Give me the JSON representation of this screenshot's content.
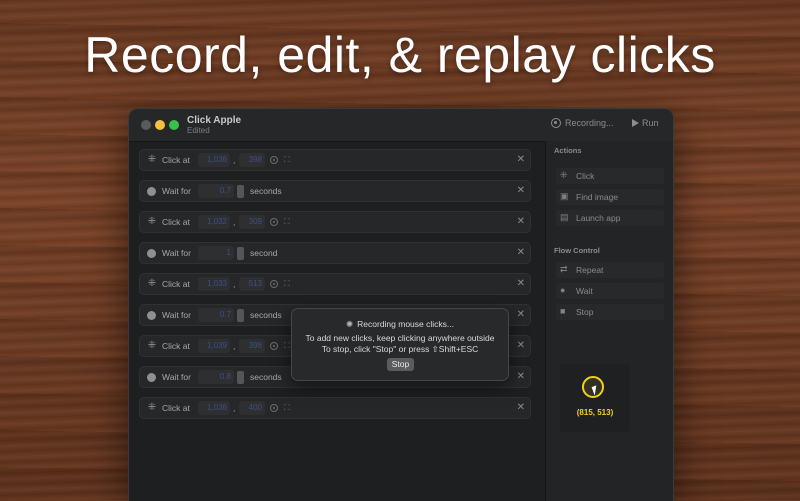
{
  "headline": "Record, edit, & replay clicks",
  "window": {
    "title": "Click Apple",
    "subtitle": "Edited",
    "recording_label": "Recording...",
    "run_label": "Run"
  },
  "steps": [
    {
      "type": "click",
      "label": "Click at",
      "x": "1,036",
      "y": "398"
    },
    {
      "type": "wait",
      "label": "Wait for",
      "value": "0.7",
      "unit": "seconds"
    },
    {
      "type": "click",
      "label": "Click at",
      "x": "1,032",
      "y": "309"
    },
    {
      "type": "wait",
      "label": "Wait for",
      "value": "1",
      "unit": "second"
    },
    {
      "type": "click",
      "label": "Click at",
      "x": "1,033",
      "y": "513"
    },
    {
      "type": "wait",
      "label": "Wait for",
      "value": "0.7",
      "unit": "seconds"
    },
    {
      "type": "click",
      "label": "Click at",
      "x": "1,039",
      "y": "398"
    },
    {
      "type": "wait",
      "label": "Wait for",
      "value": "0.8",
      "unit": "seconds"
    },
    {
      "type": "click",
      "label": "Click at",
      "x": "1,036",
      "y": "400"
    }
  ],
  "sidebar": {
    "actions_title": "Actions",
    "actions": [
      {
        "label": "Click",
        "icon": "click-icon"
      },
      {
        "label": "Find image",
        "icon": "image-icon"
      },
      {
        "label": "Launch app",
        "icon": "app-icon"
      }
    ],
    "flow_title": "Flow Control",
    "flow": [
      {
        "label": "Repeat",
        "icon": "repeat-icon"
      },
      {
        "label": "Wait",
        "icon": "wait-icon"
      },
      {
        "label": "Stop",
        "icon": "stop-icon"
      }
    ],
    "cursor_coords": "(815, 513)"
  },
  "popover": {
    "title": "Recording mouse clicks...",
    "line1": "To add new clicks, keep clicking anywhere outside",
    "line2": "To stop, click \"Stop\" or press ⇧Shift+ESC",
    "stop_label": "Stop"
  },
  "colors": {
    "accent_yellow": "#f0d21b",
    "window_bg": "#1e1f21"
  }
}
